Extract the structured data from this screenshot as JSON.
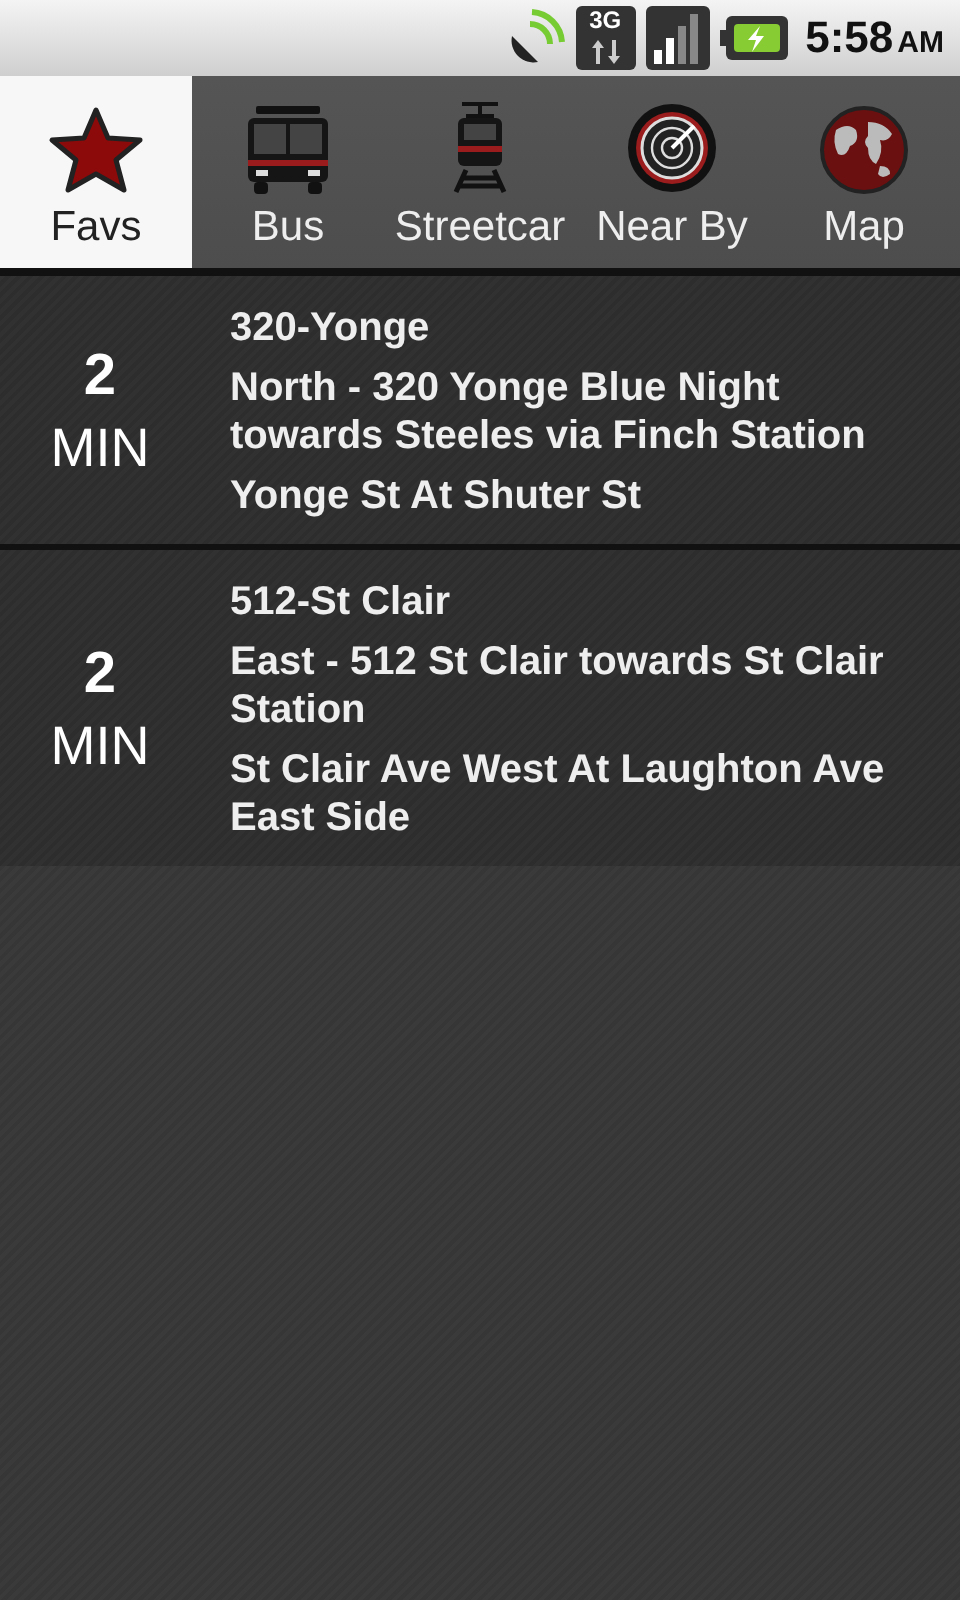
{
  "status_bar": {
    "time": "5:58",
    "meridiem": "AM",
    "network": "3G"
  },
  "tabs": [
    {
      "label": "Favs",
      "kind": "favs",
      "selected": true
    },
    {
      "label": "Bus",
      "kind": "bus",
      "selected": false
    },
    {
      "label": "Streetcar",
      "kind": "streetcar",
      "selected": false
    },
    {
      "label": "Near By",
      "kind": "nearby",
      "selected": false
    },
    {
      "label": "Map",
      "kind": "map",
      "selected": false
    }
  ],
  "arrivals": [
    {
      "minutes": "2",
      "unit": "MIN",
      "route": "320-Yonge",
      "direction": "North - 320 Yonge Blue Night towards Steeles via Finch Station",
      "stop": "Yonge St At Shuter St"
    },
    {
      "minutes": "2",
      "unit": "MIN",
      "route": "512-St Clair",
      "direction": "East - 512 St Clair towards St Clair Station",
      "stop": "St Clair Ave West At Laughton Ave East Side"
    }
  ]
}
